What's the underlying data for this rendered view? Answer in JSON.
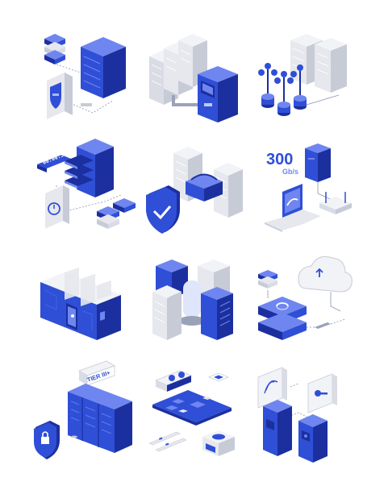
{
  "labels": {
    "speed_value": "300",
    "speed_unit": "Gb/s",
    "timer": "00:00:56",
    "tier": "TIER III+"
  },
  "colors": {
    "primary_blue": "#2f4fd6",
    "dark_blue": "#1c2f9e",
    "light_blue": "#6f86f0",
    "server_gray": "#e6e8ee",
    "server_gray_dark": "#c7cbd6",
    "line": "#8a94b4"
  },
  "icons": [
    "server-storage-security-icon",
    "datacenter-atm-icon",
    "server-network-cluster-icon",
    "server-backup-timer-icon",
    "server-power-shield-icon",
    "network-speed-icon",
    "secure-vault-door-icon",
    "server-cooling-icon",
    "cloud-sync-icon",
    "tier-datacenter-icon",
    "hardware-components-icon",
    "server-access-control-icon"
  ]
}
